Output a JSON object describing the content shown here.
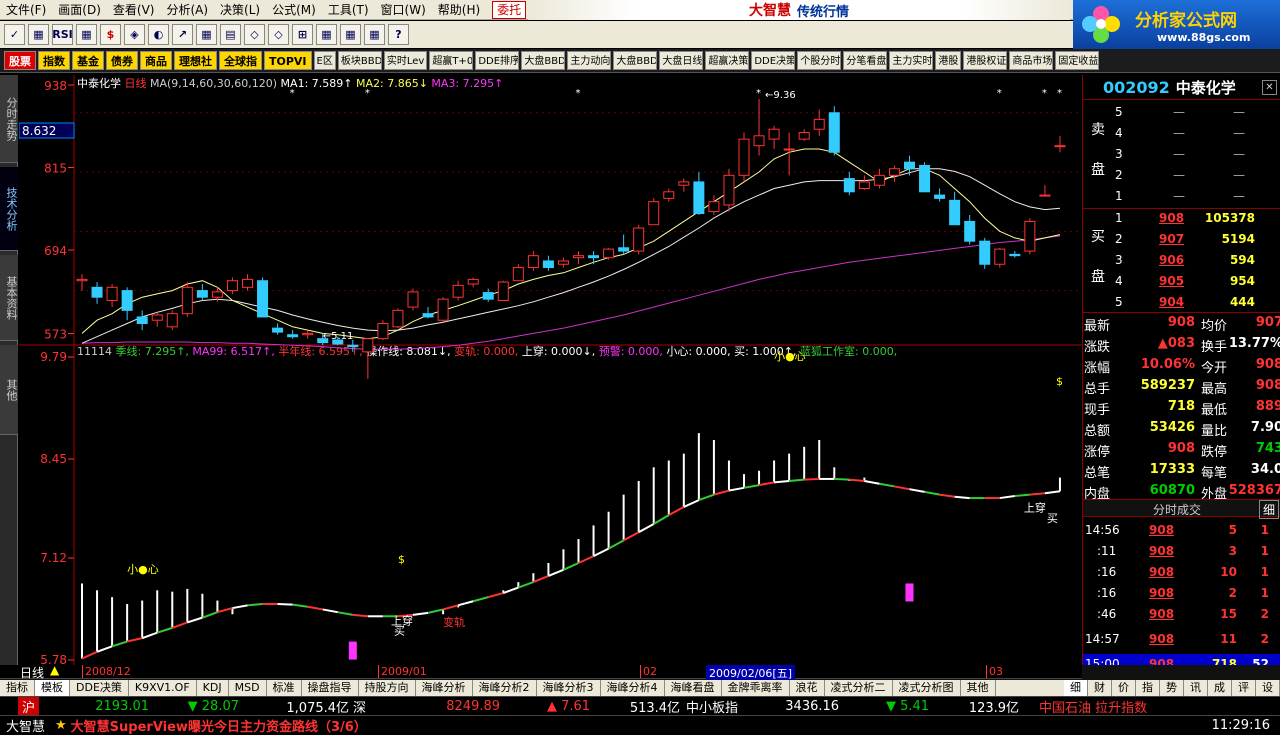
{
  "menu": [
    "文件(F)",
    "画面(D)",
    "查看(V)",
    "分析(A)",
    "决策(L)",
    "公式(M)",
    "工具(T)",
    "窗口(W)",
    "帮助(H)"
  ],
  "menu_trade": "委托",
  "brand": {
    "title": "大智慧",
    "sub": "传统行情"
  },
  "logo": {
    "title": "分析家公式网",
    "url": "www.88gs.com"
  },
  "toolbar": [
    "✓",
    "▦",
    "RSI",
    "▦",
    "$",
    "◈",
    "◐",
    "↗",
    "▦",
    "▤",
    "◇",
    "◇",
    "⊞",
    "▦",
    "▦",
    "▦",
    "?"
  ],
  "quickbar": [
    "股票",
    "指数",
    "基金",
    "债券",
    "商品",
    "理想社",
    "全球指",
    "TOPVI",
    "E区",
    "板块BBD",
    "实时Lev",
    "超赢T+0",
    "DDE排序",
    "大盘BBD",
    "主力动向",
    "大盘BBD",
    "大盘日线",
    "超赢决策",
    "DDE决策",
    "个股分时",
    "分笔看盘",
    "主力实时",
    "港股",
    "港股权证",
    "商品市场",
    "固定收益"
  ],
  "lefttabs": [
    "分时走势",
    "技术分析",
    "基本资料",
    "其他"
  ],
  "header1": {
    "code": "中泰化学",
    "period": "日线",
    "ma": "MA(9,14,60,30,60,120)",
    "ma1": "MA1: 7.589↑",
    "ma2": "MA2: 7.865↓",
    "ma3": "MA3: 7.295↑"
  },
  "header2": {
    "id": "11114",
    "parts": [
      "季线: 7.295↑",
      "MA99: 6.517↑",
      "半年线: 6.595↑",
      "操作线: 8.081↓",
      "变轨: 0.000",
      "上穿: 0.000↓",
      "预警: 0.000",
      "小心: 0.000",
      "买: 1.000↑",
      "蓝狐工作室: 0.000"
    ]
  },
  "axis": {
    "top": [
      "938",
      "815",
      "694",
      "573"
    ],
    "bottom": [
      "9.79",
      "8.45",
      "7.12",
      "5.78"
    ],
    "cursor_price": "8.632"
  },
  "annotations": {
    "high": "9.36",
    "low": "5.11",
    "careful": "小●心",
    "dollar": "$",
    "up_cross": "上穿",
    "buy": "买",
    "change": "变轨"
  },
  "time_axis": {
    "period_label": "日线",
    "labels": [
      "2008/12",
      "2009/01",
      "02",
      "03"
    ],
    "cursor": "2009/02/06[五]"
  },
  "chart_data": {
    "type": "candlestick",
    "ylim": [
      5.7,
      9.45
    ],
    "ohlc": [
      [
        6.6,
        6.7,
        6.45,
        6.62
      ],
      [
        6.5,
        6.58,
        6.25,
        6.35
      ],
      [
        6.3,
        6.55,
        6.2,
        6.5
      ],
      [
        6.45,
        6.5,
        6.0,
        6.15
      ],
      [
        6.05,
        6.15,
        5.85,
        5.95
      ],
      [
        6.0,
        6.12,
        5.9,
        6.08
      ],
      [
        5.9,
        6.15,
        5.85,
        6.1
      ],
      [
        6.1,
        6.58,
        6.05,
        6.5
      ],
      [
        6.45,
        6.55,
        6.3,
        6.35
      ],
      [
        6.35,
        6.5,
        6.28,
        6.43
      ],
      [
        6.45,
        6.65,
        6.4,
        6.6
      ],
      [
        6.5,
        6.7,
        6.45,
        6.62
      ],
      [
        6.6,
        6.65,
        6.05,
        6.05
      ],
      [
        5.88,
        5.95,
        5.78,
        5.82
      ],
      [
        5.78,
        5.85,
        5.72,
        5.75
      ],
      [
        5.78,
        5.85,
        5.72,
        5.8
      ],
      [
        5.72,
        5.8,
        5.62,
        5.66
      ],
      [
        5.7,
        5.75,
        5.62,
        5.64
      ],
      [
        5.62,
        5.7,
        5.52,
        5.6
      ],
      [
        5.52,
        5.72,
        5.11,
        5.72
      ],
      [
        5.72,
        6.0,
        5.7,
        5.95
      ],
      [
        5.9,
        6.18,
        5.88,
        6.15
      ],
      [
        6.2,
        6.48,
        6.15,
        6.43
      ],
      [
        6.1,
        6.2,
        6.03,
        6.05
      ],
      [
        6.0,
        6.35,
        5.98,
        6.32
      ],
      [
        6.35,
        6.6,
        6.3,
        6.53
      ],
      [
        6.55,
        6.65,
        6.5,
        6.62
      ],
      [
        6.42,
        6.48,
        6.28,
        6.32
      ],
      [
        6.3,
        6.6,
        6.3,
        6.58
      ],
      [
        6.6,
        6.85,
        6.6,
        6.8
      ],
      [
        6.8,
        7.05,
        6.75,
        6.98
      ],
      [
        6.9,
        6.98,
        6.75,
        6.8
      ],
      [
        6.85,
        6.95,
        6.8,
        6.9
      ],
      [
        6.95,
        7.05,
        6.85,
        6.98
      ],
      [
        6.98,
        7.05,
        6.85,
        6.95
      ],
      [
        6.95,
        7.1,
        6.92,
        7.08
      ],
      [
        7.1,
        7.3,
        7.0,
        7.05
      ],
      [
        7.05,
        7.45,
        7.0,
        7.4
      ],
      [
        7.45,
        7.85,
        7.45,
        7.8
      ],
      [
        7.85,
        8.0,
        7.8,
        7.95
      ],
      [
        8.05,
        8.15,
        7.95,
        8.1
      ],
      [
        8.1,
        8.25,
        7.6,
        7.62
      ],
      [
        7.65,
        7.9,
        7.6,
        7.8
      ],
      [
        7.75,
        8.3,
        7.65,
        8.2
      ],
      [
        8.2,
        8.85,
        8.1,
        8.75
      ],
      [
        8.65,
        9.36,
        8.5,
        8.8
      ],
      [
        8.75,
        8.95,
        8.6,
        8.9
      ],
      [
        8.6,
        8.85,
        8.2,
        8.6
      ],
      [
        8.75,
        8.9,
        8.72,
        8.85
      ],
      [
        8.9,
        9.2,
        8.8,
        9.05
      ],
      [
        9.15,
        9.25,
        8.5,
        8.55
      ],
      [
        8.15,
        8.25,
        7.9,
        7.95
      ],
      [
        8.0,
        8.2,
        7.98,
        8.1
      ],
      [
        8.05,
        8.3,
        8.0,
        8.2
      ],
      [
        8.2,
        8.35,
        8.1,
        8.3
      ],
      [
        8.4,
        8.5,
        8.2,
        8.3
      ],
      [
        8.35,
        8.4,
        7.95,
        7.95
      ],
      [
        7.9,
        8.0,
        7.8,
        7.85
      ],
      [
        7.82,
        7.95,
        7.45,
        7.45
      ],
      [
        7.5,
        7.6,
        7.15,
        7.2
      ],
      [
        7.2,
        7.25,
        6.78,
        6.85
      ],
      [
        6.85,
        7.1,
        6.8,
        7.08
      ],
      [
        7.0,
        7.05,
        6.95,
        6.98
      ],
      [
        7.05,
        7.55,
        7.0,
        7.5
      ],
      [
        7.9,
        8.05,
        7.9,
        7.9
      ],
      [
        8.65,
        8.8,
        8.55,
        8.65
      ]
    ],
    "ma_yellow": [
      5.8,
      6.0,
      6.1,
      6.25,
      6.35,
      6.4,
      6.45,
      6.55,
      6.6,
      6.5,
      6.3,
      6.2,
      6.1,
      6.0,
      5.9,
      5.85,
      5.8,
      5.78,
      5.75,
      5.72,
      5.75,
      5.85,
      5.98,
      6.08,
      6.15,
      6.22,
      6.3,
      6.38,
      6.45,
      6.55,
      6.62,
      6.68,
      6.72,
      6.8,
      6.88,
      6.95,
      7.0,
      7.1,
      7.2,
      7.35,
      7.5,
      7.65,
      7.8,
      7.95,
      8.1,
      8.25,
      8.45,
      8.55,
      8.6,
      8.6,
      8.55,
      8.4,
      8.25,
      8.1,
      8.2,
      8.3,
      8.3,
      8.2,
      8.0,
      7.8,
      7.55,
      7.35,
      7.25,
      7.2,
      7.25,
      7.3
    ],
    "ma_white": [
      5.65,
      5.75,
      5.85,
      5.95,
      6.05,
      6.12,
      6.18,
      6.25,
      6.3,
      6.32,
      6.3,
      6.25,
      6.2,
      6.15,
      6.08,
      6.02,
      5.97,
      5.92,
      5.88,
      5.85,
      5.84,
      5.85,
      5.88,
      5.93,
      5.97,
      6.02,
      6.07,
      6.12,
      6.17,
      6.22,
      6.28,
      6.35,
      6.42,
      6.5,
      6.58,
      6.67,
      6.77,
      6.88,
      7.0,
      7.12,
      7.26,
      7.4,
      7.55,
      7.68,
      7.8,
      7.9,
      8.0,
      8.05,
      8.1,
      8.12,
      8.12,
      8.12,
      8.12,
      8.14,
      8.18,
      8.24,
      8.3,
      8.3,
      8.26,
      8.18,
      8.05,
      7.92,
      7.8,
      7.72,
      7.68,
      7.7
    ],
    "ma_magenta": [
      5.65,
      5.66,
      5.66,
      5.67,
      5.67,
      5.67,
      5.67,
      5.67,
      5.66,
      5.66,
      5.65,
      5.65,
      5.64,
      5.63,
      5.62,
      5.61,
      5.6,
      5.58,
      5.57,
      5.56,
      5.56,
      5.56,
      5.57,
      5.58,
      5.6,
      5.62,
      5.65,
      5.68,
      5.72,
      5.76,
      5.8,
      5.84,
      5.88,
      5.93,
      5.98,
      6.03,
      6.08,
      6.14,
      6.2,
      6.26,
      6.32,
      6.38,
      6.44,
      6.5,
      6.56,
      6.62,
      6.67,
      6.72,
      6.76,
      6.8,
      6.84,
      6.88,
      6.91,
      6.94,
      6.97,
      7.0,
      7.03,
      7.06,
      7.09,
      7.12,
      7.15,
      7.18,
      7.2,
      7.22,
      7.25,
      7.28
    ],
    "bottom_ylim": [
      5.78,
      10.2
    ],
    "bottom_line": [
      5.8,
      5.9,
      5.98,
      6.05,
      6.1,
      6.18,
      6.25,
      6.33,
      6.4,
      6.48,
      6.54,
      6.58,
      6.6,
      6.6,
      6.59,
      6.56,
      6.52,
      6.48,
      6.44,
      6.42,
      6.42,
      6.42,
      6.44,
      6.47,
      6.52,
      6.58,
      6.64,
      6.7,
      6.76,
      6.84,
      6.92,
      7.01,
      7.1,
      7.2,
      7.3,
      7.41,
      7.53,
      7.65,
      7.77,
      7.9,
      8.02,
      8.12,
      8.2,
      8.26,
      8.3,
      8.34,
      8.38,
      8.4,
      8.42,
      8.43,
      8.43,
      8.42,
      8.4,
      8.36,
      8.32,
      8.28,
      8.24,
      8.2,
      8.17,
      8.15,
      8.15,
      8.15,
      8.18,
      8.2,
      8.22,
      8.25
    ],
    "bottom_bars": [
      6.9,
      6.8,
      6.7,
      6.6,
      6.65,
      6.8,
      6.78,
      6.82,
      6.75,
      6.65,
      6.45,
      0,
      0,
      0,
      0,
      0,
      0,
      0,
      0,
      0,
      0,
      0,
      0,
      0,
      6.45,
      6.55,
      6.65,
      6.7,
      6.8,
      6.92,
      7.05,
      7.2,
      7.4,
      7.55,
      7.75,
      7.95,
      8.2,
      8.4,
      8.6,
      8.7,
      8.8,
      9.1,
      9.0,
      8.7,
      8.5,
      8.55,
      8.7,
      8.8,
      8.9,
      9.0,
      8.6,
      8.4,
      8.45,
      0,
      0,
      0,
      0,
      0,
      0,
      0,
      0,
      0,
      0,
      0,
      0,
      8.45
    ]
  },
  "right_panel": {
    "code": "002092",
    "name": "中泰化学",
    "asks": [
      {
        "level": "5",
        "price": "—",
        "vol": "—"
      },
      {
        "level": "4",
        "price": "—",
        "vol": "—"
      },
      {
        "level": "3",
        "price": "—",
        "vol": "—"
      },
      {
        "level": "2",
        "price": "—",
        "vol": "—"
      },
      {
        "level": "1",
        "price": "—",
        "vol": "—"
      }
    ],
    "ask_label": [
      "卖",
      "盘"
    ],
    "bids": [
      {
        "level": "1",
        "price": "908",
        "vol": "105378"
      },
      {
        "level": "2",
        "price": "907",
        "vol": "5194"
      },
      {
        "level": "3",
        "price": "906",
        "vol": "594"
      },
      {
        "level": "4",
        "price": "905",
        "vol": "954"
      },
      {
        "level": "5",
        "price": "904",
        "vol": "444"
      }
    ],
    "bid_label": [
      "买",
      "盘"
    ],
    "stats": [
      [
        "最新",
        "908",
        "均价",
        "907"
      ],
      [
        "涨跌",
        "▲083",
        "换手",
        "13.77%"
      ],
      [
        "涨幅",
        "10.06%",
        "今开",
        "908"
      ],
      [
        "总手",
        "589237",
        "最高",
        "908"
      ],
      [
        "现手",
        "718",
        "最低",
        "889"
      ],
      [
        "总额",
        "53426",
        "量比",
        "7.90"
      ],
      [
        "涨停",
        "908",
        "跌停",
        "743"
      ],
      [
        "总笔",
        "17333",
        "每笔",
        "34.0"
      ],
      [
        "内盘",
        "60870",
        "外盘",
        "528367"
      ]
    ],
    "ticks_title": "分时成交",
    "ticks_btn": "细",
    "ticks": [
      [
        "14:56",
        "908",
        "5",
        "1"
      ],
      [
        ":11",
        "908",
        "3",
        "1"
      ],
      [
        ":16",
        "908",
        "10",
        "1"
      ],
      [
        ":16",
        "908",
        "2",
        "1"
      ],
      [
        ":46",
        "908",
        "15",
        "2"
      ],
      [
        "14:57",
        "908",
        "11",
        "2"
      ],
      [
        "15:00",
        "908",
        "718",
        "52"
      ]
    ]
  },
  "bottom_tabs": [
    "指标",
    "模板",
    "DDE决策",
    "K9XV1.OF",
    "KDJ",
    "MSD",
    "标准",
    "操盘指导",
    "持股方向",
    "海峰分析",
    "海峰分析2",
    "海峰分析3",
    "海峰分析4",
    "海峰看盘",
    "金牌乖离率",
    "浪花",
    "凌式分析二",
    "凌式分析图",
    "其他"
  ],
  "right_tabs": [
    "细",
    "财",
    "价",
    "指",
    "势",
    "讯",
    "成",
    "评",
    "设"
  ],
  "index_bar": {
    "sh": "沪",
    "sh_val": "2193.01",
    "sh_chg": "▼ 28.07",
    "sh_amt": "1,075.4亿",
    "sz": "深",
    "sz_val": "8249.89",
    "sz_chg": "▲ 7.61",
    "sz_amt": "513.4亿",
    "sme": "中小板指",
    "sme_val": "3436.16",
    "sme_chg": "▼ 5.41",
    "sme_amt": "123.9亿",
    "news": "中国石油 拉升指数"
  },
  "status_bar": {
    "brand": "大智慧",
    "scroll": "大智慧SuperView曝光今日主力资金路线（3/6）",
    "time": "11:29:16"
  }
}
